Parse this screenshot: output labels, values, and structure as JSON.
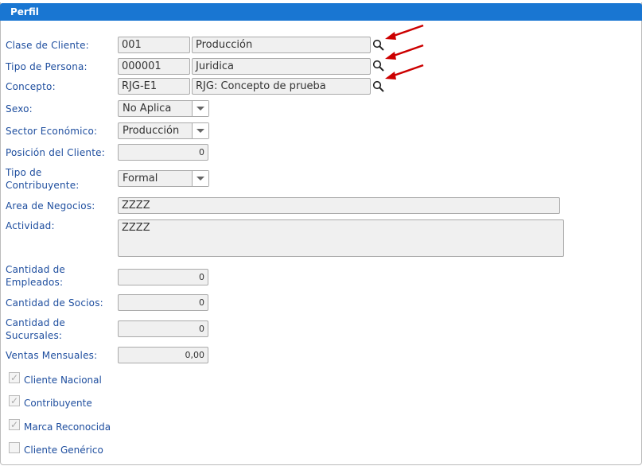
{
  "header": {
    "title": "Perfil"
  },
  "fields": {
    "clase": {
      "label": "Clase de Cliente:",
      "code": "001",
      "desc": "Producción"
    },
    "tipo_persona": {
      "label": "Tipo de Persona:",
      "code": "000001",
      "desc": "Juridica"
    },
    "concepto": {
      "label": "Concepto:",
      "code": "RJG-E1",
      "desc": "RJG: Concepto de prueba"
    },
    "sexo": {
      "label": "Sexo:",
      "value": "No Aplica"
    },
    "sector": {
      "label": "Sector Económico:",
      "value": "Producción"
    },
    "posicion": {
      "label": "Posición del Cliente:",
      "value": "0"
    },
    "tipo_contrib": {
      "label1": "Tipo de",
      "label2": "Contribuyente:",
      "value": "Formal"
    },
    "area": {
      "label": "Area de Negocios:",
      "value": "ZZZZ"
    },
    "actividad": {
      "label": "Actividad:",
      "value": "ZZZZ"
    },
    "empleados": {
      "label1": "Cantidad de",
      "label2": "Empleados:",
      "value": "0"
    },
    "socios": {
      "label": "Cantidad de Socios:",
      "value": "0"
    },
    "sucursales": {
      "label1": "Cantidad de",
      "label2": "Sucursales:",
      "value": "0"
    },
    "ventas": {
      "label": "Ventas Mensuales:",
      "value": "0,00"
    }
  },
  "checkboxes": [
    {
      "label": "Cliente Nacional",
      "checked": true
    },
    {
      "label": "Contribuyente",
      "checked": true
    },
    {
      "label": "Marca Reconocida",
      "checked": true
    },
    {
      "label": "Cliente Genérico",
      "checked": false
    }
  ]
}
